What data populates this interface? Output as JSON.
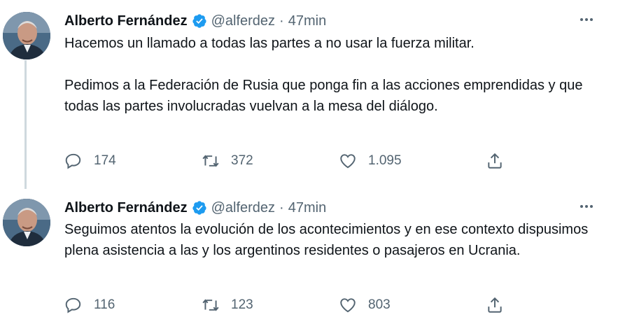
{
  "tweets": [
    {
      "author": "Alberto Fernández",
      "handle": "@alferdez",
      "separator": "·",
      "time": "47min",
      "paragraphs": [
        "Hacemos un llamado a todas las partes a no usar la fuerza militar.",
        "Pedimos a la Federación de Rusia que ponga fin a las acciones emprendidas y que todas las partes involucradas vuelvan a la mesa del diálogo."
      ],
      "replies": "174",
      "retweets": "372",
      "likes": "1.095"
    },
    {
      "author": "Alberto Fernández",
      "handle": "@alferdez",
      "separator": "·",
      "time": "47min",
      "paragraphs": [
        "Seguimos atentos la evolución de los acontecimientos y en ese contexto dispusimos plena asistencia a las y los argentinos residentes o pasajeros en Ucrania."
      ],
      "replies": "116",
      "retweets": "123",
      "likes": "803"
    }
  ],
  "icons": {
    "more": "more-icon",
    "verified": "verified-badge-icon",
    "reply": "reply-icon",
    "retweet": "retweet-icon",
    "like": "like-icon",
    "share": "share-icon"
  },
  "colors": {
    "text": "#0f1419",
    "secondary": "#536471",
    "verified": "#1d9bf0",
    "thread_line": "#cfd9de"
  }
}
